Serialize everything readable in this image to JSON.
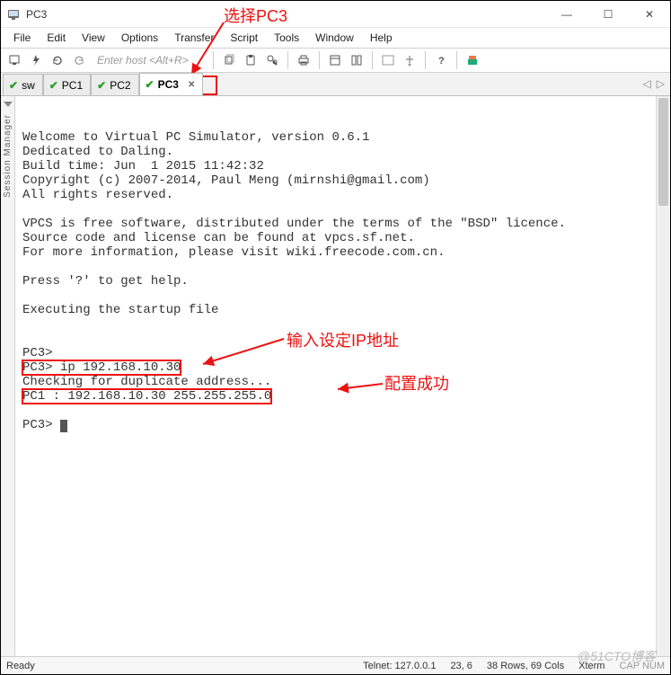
{
  "window": {
    "title": "PC3",
    "minimize": "—",
    "maximize": "☐",
    "close": "✕"
  },
  "menu": {
    "items": [
      "File",
      "Edit",
      "View",
      "Options",
      "Transfer",
      "Script",
      "Tools",
      "Window",
      "Help"
    ]
  },
  "toolbar": {
    "host_placeholder": "Enter host <Alt+R>"
  },
  "tabs": {
    "items": [
      {
        "label": "sw",
        "checked": true,
        "active": false
      },
      {
        "label": "PC1",
        "checked": true,
        "active": false
      },
      {
        "label": "PC2",
        "checked": true,
        "active": false
      },
      {
        "label": "PC3",
        "checked": true,
        "active": true
      }
    ]
  },
  "sidebar": {
    "label": "Session Manager"
  },
  "terminal": {
    "lines": [
      "",
      "Welcome to Virtual PC Simulator, version 0.6.1",
      "Dedicated to Daling.",
      "Build time: Jun  1 2015 11:42:32",
      "Copyright (c) 2007-2014, Paul Meng (mirnshi@gmail.com)",
      "All rights reserved.",
      "",
      "VPCS is free software, distributed under the terms of the \"BSD\" licence.",
      "Source code and license can be found at vpcs.sf.net.",
      "For more information, please visit wiki.freecode.com.cn.",
      "",
      "Press '?' to get help.",
      "",
      "Executing the startup file",
      "",
      ""
    ],
    "l_pc3_blank": "PC3>",
    "l_pc3_ip": "PC3> ip 192.168.10.30",
    "l_check": "Checking for duplicate address...",
    "l_pc1": "PC1 : 192.168.10.30 255.255.255.0",
    "l_prompt": "PC3> "
  },
  "annotations": {
    "select_pc3": "选择PC3",
    "input_ip": "输入设定IP地址",
    "config_ok": "配置成功"
  },
  "status": {
    "ready": "Ready",
    "conn": "Telnet: 127.0.0.1",
    "pos": "23,   6",
    "size": "38 Rows, 69 Cols",
    "term": "Xterm",
    "caps": "CAP NUM"
  },
  "watermark": "@51CTO博客",
  "colors": {
    "annotation_red": "#e11",
    "tab_check_green": "#22a022"
  }
}
